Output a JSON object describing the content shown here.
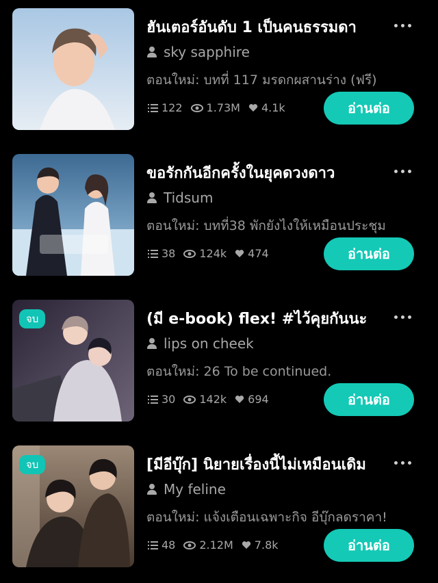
{
  "novels": [
    {
      "title": "ฮันเตอร์อันดับ 1 เป็นคนธรรมดา",
      "author": "sky sapphire",
      "latest": "ตอนใหม่: บทที่ 117 มรดกผสานร่าง (ฟรี)",
      "chapters": "122",
      "views": "1.73M",
      "likes": "4.1k",
      "badge": "",
      "read_label": "อ่านต่อ"
    },
    {
      "title": "ขอรักกันอีกครั้งในยุคดวงดาว",
      "author": "Tidsum",
      "latest": "ตอนใหม่: บทที่38 พักยังไงให้เหมือนประชุม",
      "chapters": "38",
      "views": "124k",
      "likes": "474",
      "badge": "",
      "read_label": "อ่านต่อ"
    },
    {
      "title": "(มี e-book) flex! #ไว้คุยกันนะ",
      "author": "lips on cheek",
      "latest": "ตอนใหม่: 26 To be continued.",
      "chapters": "30",
      "views": "142k",
      "likes": "694",
      "badge": "จบ",
      "read_label": "อ่านต่อ"
    },
    {
      "title": "[มีอีบุ๊ก] นิยายเรื่องนี้ไม่เหมือนเดิม",
      "author": "My feline",
      "latest": "ตอนใหม่: แจ้งเตือนเฉพาะกิจ อีบุ๊กลดราคา!",
      "chapters": "48",
      "views": "2.12M",
      "likes": "7.8k",
      "badge": "จบ",
      "read_label": "อ่านต่อ"
    }
  ],
  "colors": {
    "accent": "#14c9b6",
    "background": "#000000",
    "muted": "#a8a8a8"
  }
}
